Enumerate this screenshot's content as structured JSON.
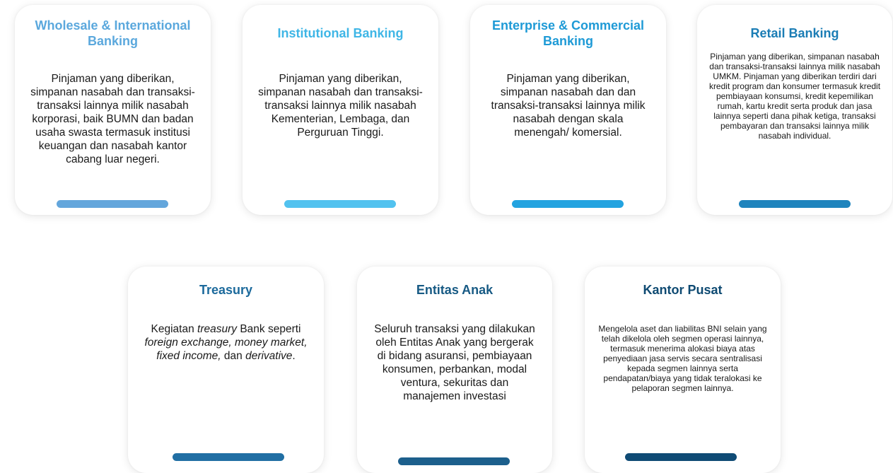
{
  "segments_top": [
    {
      "title": "Wholesale & International Banking",
      "description": "Pinjaman yang diberikan, simpanan nasabah dan transaksi-transaksi lainnya milik nasabah korporasi, baik BUMN dan badan usaha swasta termasuk institusi keuangan dan nasabah kantor cabang luar negeri.",
      "title_color": "#5ba8dd",
      "bar_color": "#63a6dc"
    },
    {
      "title": "Institutional Banking",
      "description": "Pinjaman yang diberikan, simpanan nasabah dan transaksi-transaksi lainnya milik nasabah Kementerian, Lembaga, dan Perguruan Tinggi.",
      "title_color": "#3fb6e6",
      "bar_color": "#52c2ef"
    },
    {
      "title": "Enterprise & Commercial Banking",
      "description": "Pinjaman yang diberikan, simpanan nasabah dan dan transaksi-transaksi lainnya milik nasabah dengan skala menengah/ komersial.",
      "title_color": "#1e9ad6",
      "bar_color": "#23a3e0"
    },
    {
      "title": "Retail Banking",
      "description": "Pinjaman yang diberikan, simpanan nasabah dan transaksi-transaksi lainnya milik nasabah UMKM. Pinjaman yang diberikan terdiri dari kredit program dan konsumer termasuk kredit pembiayaan konsumsi, kredit kepemilikan rumah, kartu kredit serta produk dan jasa lainnya seperti dana pihak ketiga, transaksi pembayaran dan transaksi lainnya milik nasabah individual.",
      "title_color": "#1b7db5",
      "bar_color": "#1f84bd"
    }
  ],
  "segments_bottom": [
    {
      "title": "Treasury",
      "description_parts": {
        "p1": "Kegiatan ",
        "i1": "treasury",
        "p2": " Bank seperti ",
        "i2": "foreign exchange, money market, fixed income,",
        "p3": " dan ",
        "i3": "derivative",
        "p4": "."
      },
      "title_color": "#1c6a9c",
      "bar_color": "#216fa4"
    },
    {
      "title": "Entitas Anak",
      "description": "Seluruh transaksi yang dilakukan oleh Entitas Anak yang bergerak di bidang asuransi, pembiayaan konsumen, perbankan, modal ventura, sekuritas dan manajemen investasi",
      "title_color": "#175a84",
      "bar_color": "#1c5f8c"
    },
    {
      "title": "Kantor Pusat",
      "description": "Mengelola aset dan liabilitas BNI selain yang telah dikelola oleh segmen operasi lainnya, termasuk menerima alokasi biaya atas penyediaan jasa servis secara sentralisasi kepada segmen lainnya serta pendapatan/biaya yang tidak teralokasi ke pelaporan segmen lainnya.",
      "title_color": "#0e4a72",
      "bar_color": "#0f4b75"
    }
  ]
}
